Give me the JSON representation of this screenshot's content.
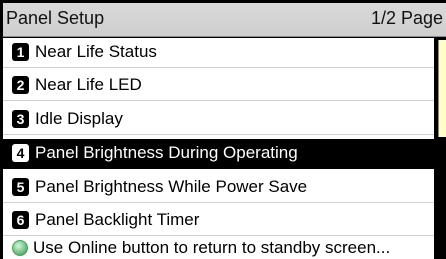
{
  "header": {
    "title": "Panel Setup",
    "page_indicator": "1/2 Page"
  },
  "menu": {
    "items": [
      {
        "number": "1",
        "label": "Near Life Status",
        "selected": false
      },
      {
        "number": "2",
        "label": "Near Life LED",
        "selected": false
      },
      {
        "number": "3",
        "label": "Idle Display",
        "selected": false
      },
      {
        "number": "4",
        "label": "Panel Brightness During Operating",
        "selected": true
      },
      {
        "number": "5",
        "label": "Panel Brightness While Power Save",
        "selected": false
      },
      {
        "number": "6",
        "label": "Panel Backlight Timer",
        "selected": false
      }
    ]
  },
  "footer": {
    "hint_text": "Use Online button to return to standby screen...",
    "hint_icon": "online-button-icon"
  },
  "colors": {
    "selected_background": "#000000",
    "selected_text": "#ffffff",
    "title_bar": "#d3d3d3",
    "side_panel": "#fffdc9",
    "online_icon": "#6cc07e"
  }
}
